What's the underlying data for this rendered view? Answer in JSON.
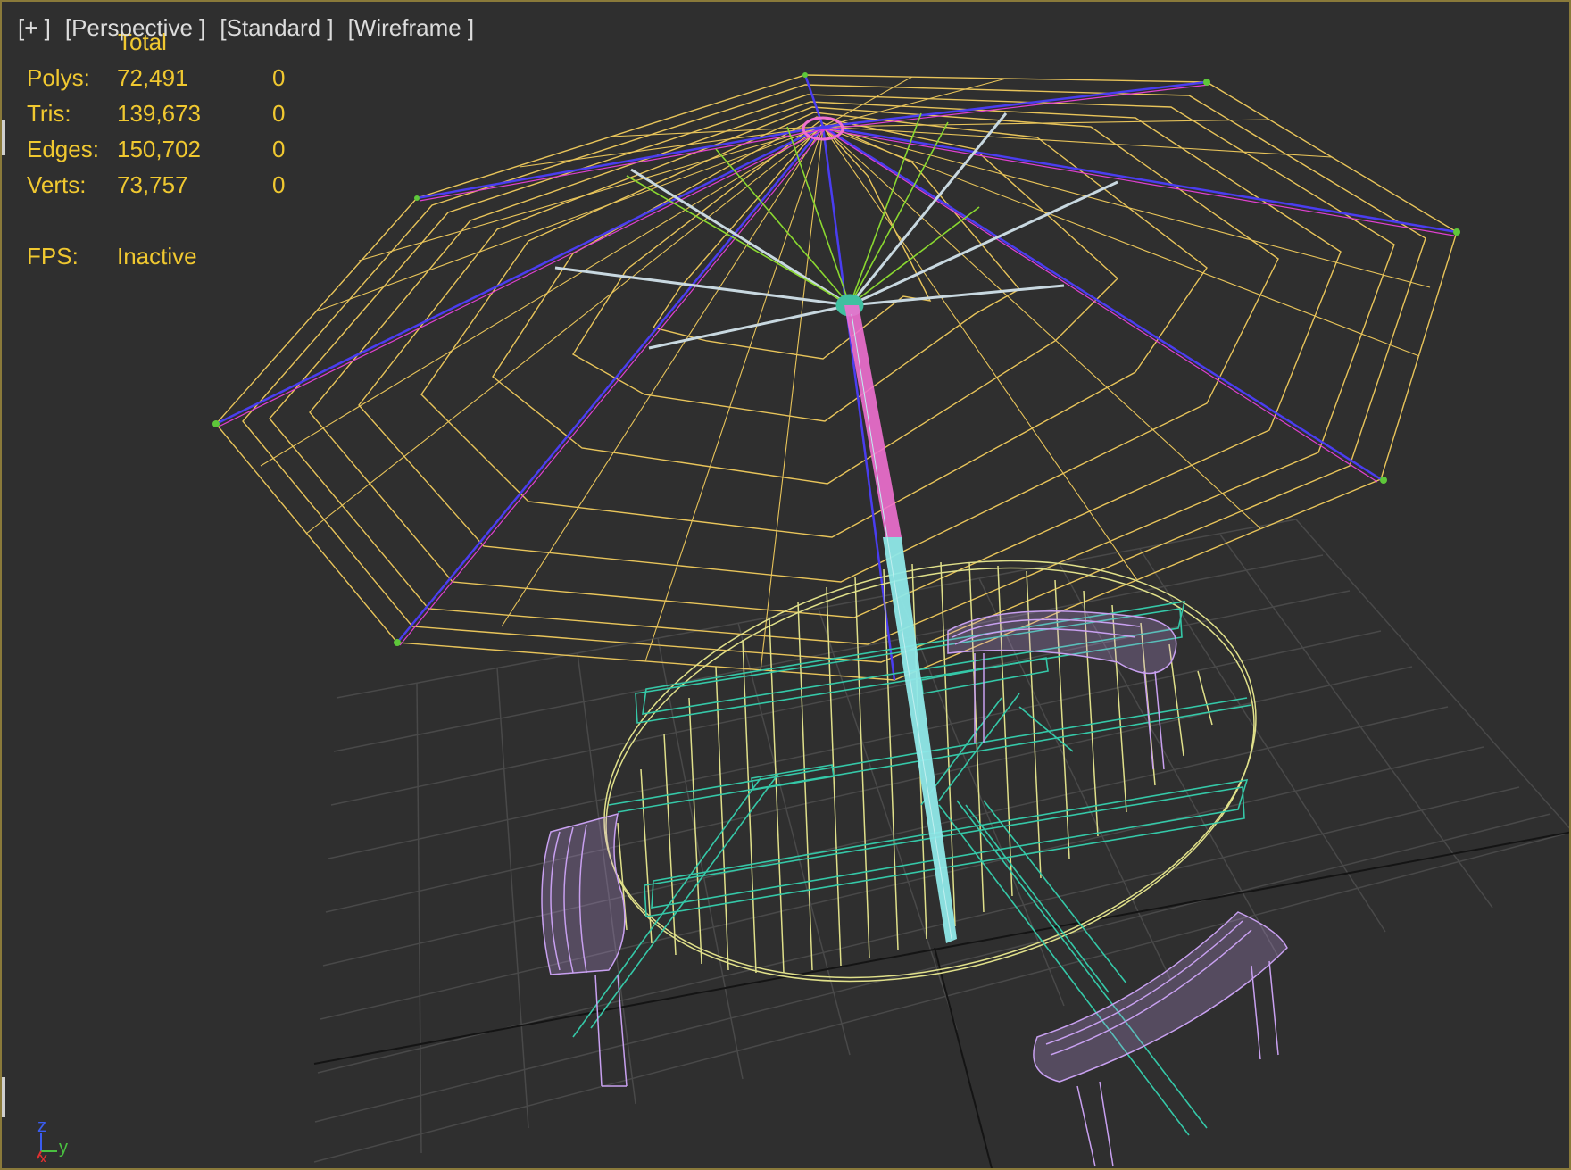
{
  "viewport": {
    "labels": [
      "[+ ]",
      "[Perspective ]",
      "[Standard ]",
      "[Wireframe ]"
    ]
  },
  "stats": {
    "header": "Total",
    "rows": [
      {
        "key": "Polys:",
        "value": "72,491",
        "selected": "0"
      },
      {
        "key": "Tris:",
        "value": "139,673",
        "selected": "0"
      },
      {
        "key": "Edges:",
        "value": "150,702",
        "selected": "0"
      },
      {
        "key": "Verts:",
        "value": "73,757",
        "selected": "0"
      }
    ],
    "fps_key": "FPS:",
    "fps_value": "Inactive"
  },
  "axis": {
    "z": "z",
    "y": "y",
    "x": "x"
  },
  "colors": {
    "canopy": "#e8c45a",
    "ribs": "#4a3df0",
    "ribs_highlight": "#e040d0",
    "pole_top": "#f070d0",
    "pole_bottom": "#8fe8e8",
    "struts": "#8ad830",
    "table_top": "#e0e08a",
    "frame": "#35c8a8",
    "benches": "#c8a0f0",
    "grid": "#4a4a4a",
    "stats_text": "#f0c830"
  }
}
